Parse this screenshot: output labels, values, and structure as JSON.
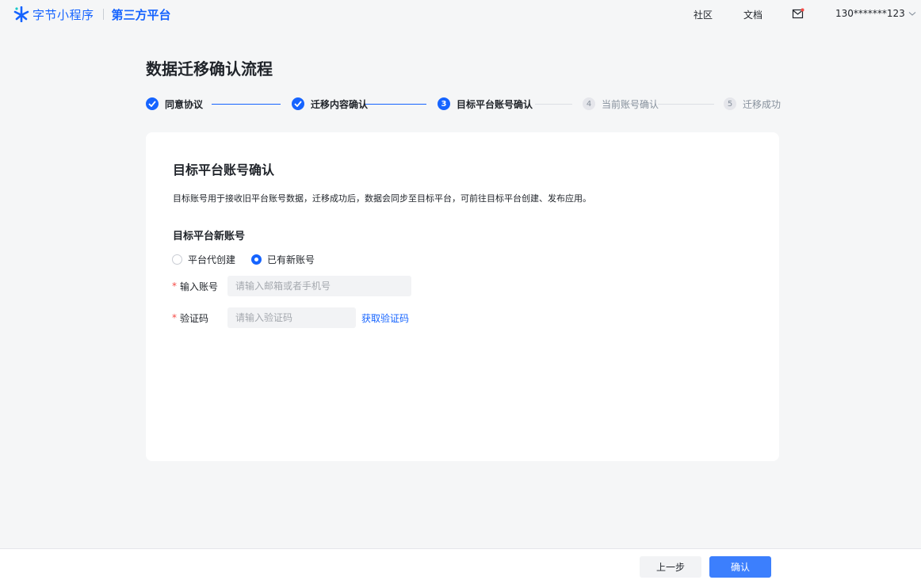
{
  "header": {
    "brand": "字节小程序",
    "subtitle": "第三方平台",
    "nav": [
      "社区",
      "文档"
    ],
    "user": "130*******123",
    "mail_icon": "mail-icon"
  },
  "page_title": "数据迁移确认流程",
  "steps": [
    {
      "num": "1",
      "label": "同意协议",
      "state": "done"
    },
    {
      "num": "2",
      "label": "迁移内容确认",
      "state": "done"
    },
    {
      "num": "3",
      "label": "目标平台账号确认",
      "state": "active"
    },
    {
      "num": "4",
      "label": "当前账号确认",
      "state": "todo"
    },
    {
      "num": "5",
      "label": "迁移成功",
      "state": "todo"
    }
  ],
  "card": {
    "title": "目标平台账号确认",
    "desc": "目标账号用于接收旧平台账号数据，迁移成功后，数据会同步至目标平台，可前往目标平台创建、发布应用。",
    "section_title": "目标平台新账号",
    "radio": {
      "option1": "平台代创建",
      "option2": "已有新账号",
      "selected": "已有新账号"
    },
    "account": {
      "label": "输入账号",
      "placeholder": "请输入邮箱或者手机号",
      "value": ""
    },
    "code": {
      "label": "验证码",
      "placeholder": "请输入验证码",
      "value": "",
      "get_code": "获取验证码"
    },
    "required_mark": "*"
  },
  "footer": {
    "prev": "上一步",
    "confirm": "确认"
  },
  "colors": {
    "primary": "#1664ff",
    "confirm_btn": "#3c7ffd",
    "required": "#f54a45"
  }
}
